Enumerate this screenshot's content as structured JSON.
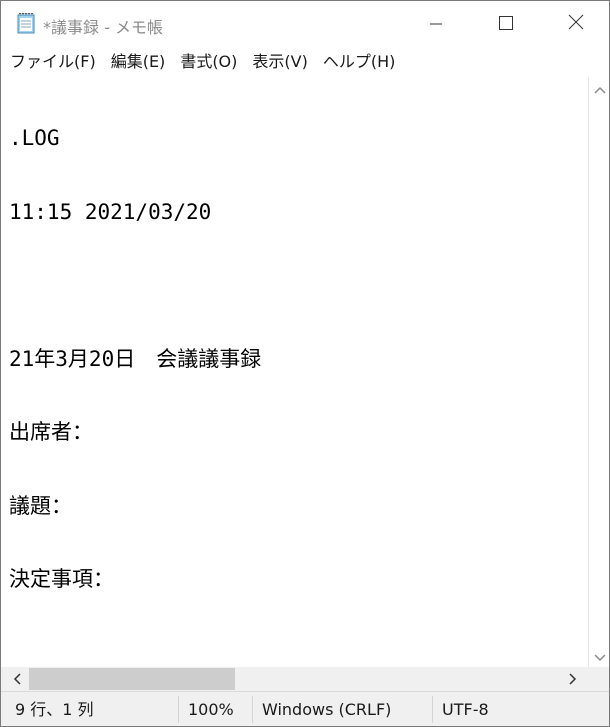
{
  "window": {
    "title": "*議事録 - メモ帳"
  },
  "menu": {
    "items": [
      {
        "label": "ファイル(F)"
      },
      {
        "label": "編集(E)"
      },
      {
        "label": "書式(O)"
      },
      {
        "label": "表示(V)"
      },
      {
        "label": "ヘルプ(H)"
      }
    ]
  },
  "editor": {
    "lines": [
      ".LOG",
      "11:15 2021/03/20",
      "",
      "21年3月20日　会議議事録",
      "出席者：",
      "議題：",
      "決定事項："
    ]
  },
  "status": {
    "position": "9 行、1 列",
    "zoom": "100%",
    "line_ending": "Windows (CRLF)",
    "encoding": "UTF-8"
  },
  "icons": {
    "app": "notepad-icon",
    "minimize": "minimize-icon",
    "maximize": "maximize-icon",
    "close": "close-icon"
  }
}
